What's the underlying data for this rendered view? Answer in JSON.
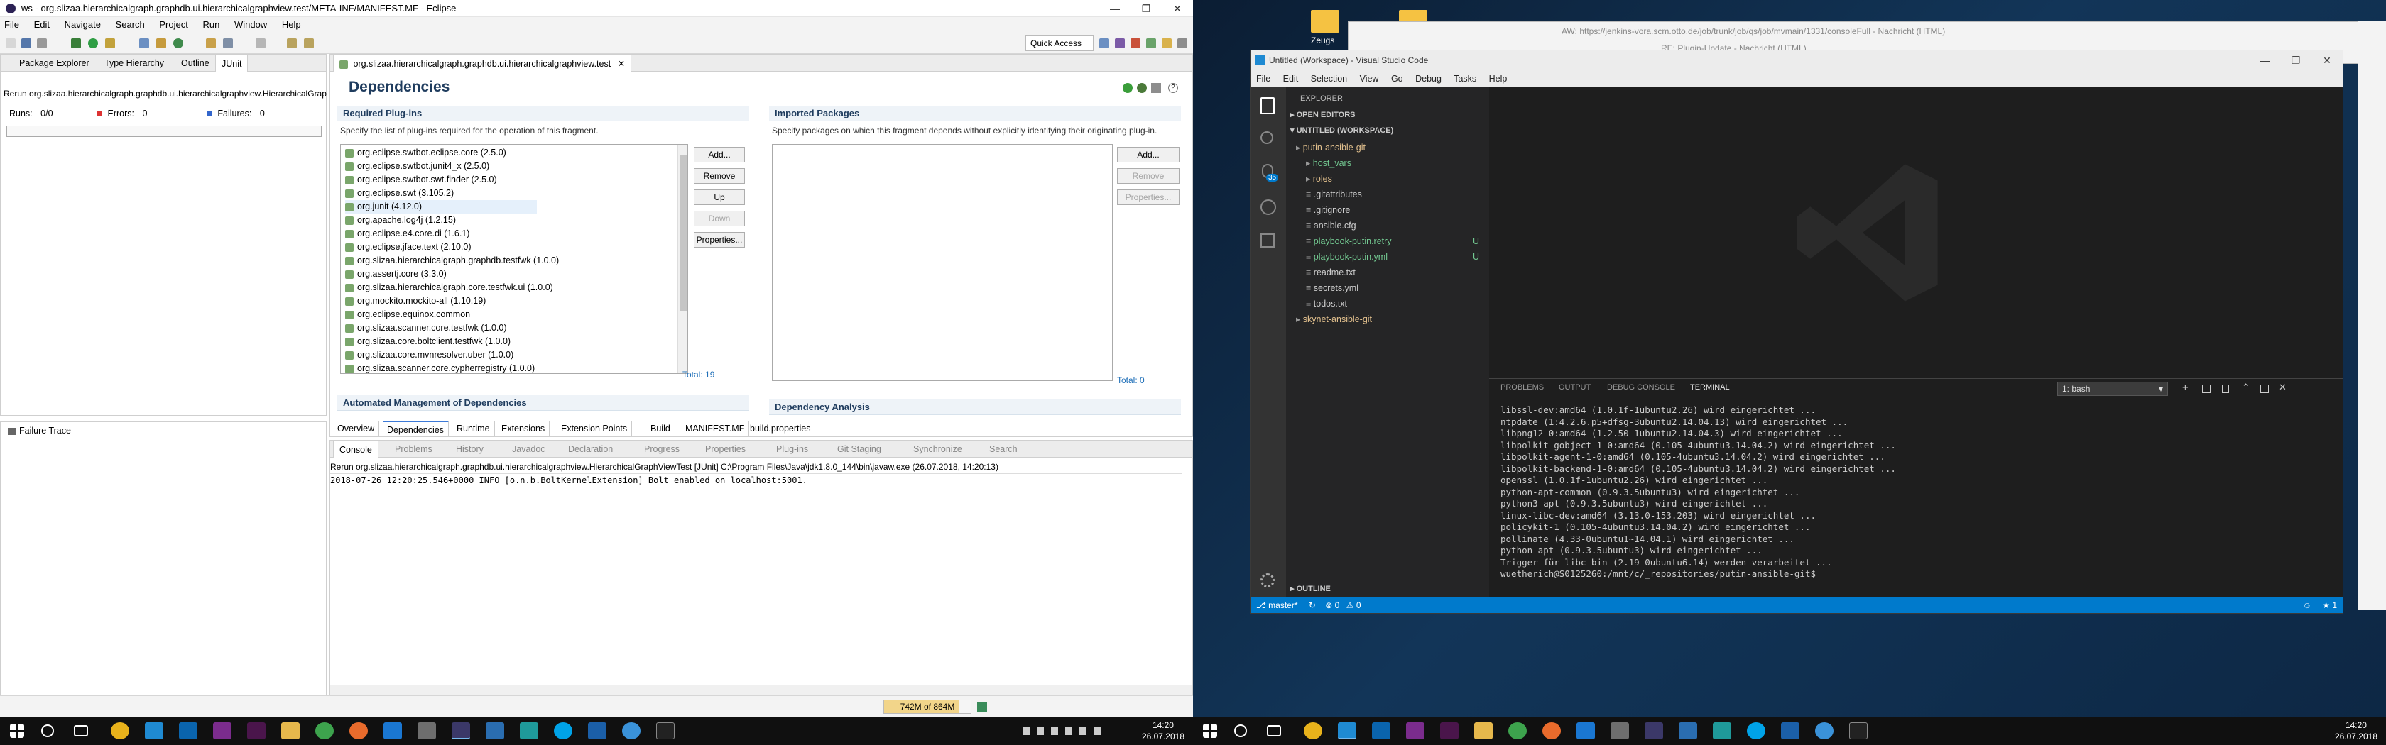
{
  "eclipse": {
    "title": "ws - org.slizaa.hierarchicalgraph.graphdb.ui.hierarchicalgraphview.test/META-INF/MANIFEST.MF - Eclipse",
    "menu": [
      "File",
      "Edit",
      "Navigate",
      "Search",
      "Project",
      "Run",
      "Window",
      "Help"
    ],
    "quick_access": "Quick Access",
    "left_tabs": [
      "Package Explorer",
      "Type Hierarchy",
      "Outline",
      "JUnit"
    ],
    "junit": {
      "rerun_text": "Rerun org.slizaa.hierarchicalgraph.graphdb.ui.hierarchicalgraphview.HierarchicalGrap",
      "runs_label": "Runs:",
      "runs_value": "0/0",
      "errors_label": "Errors:",
      "errors_value": "0",
      "failures_label": "Failures:",
      "failures_value": "0",
      "failure_trace": "Failure Trace"
    },
    "editor_tab": "org.slizaa.hierarchicalgraph.graphdb.ui.hierarchicalgraphview.test",
    "page_title": "Dependencies",
    "required": {
      "title": "Required Plug-ins",
      "desc": "Specify the list of plug-ins required for the operation of this fragment.",
      "items": [
        "org.eclipse.swtbot.eclipse.core (2.5.0)",
        "org.eclipse.swtbot.junit4_x (2.5.0)",
        "org.eclipse.swtbot.swt.finder (2.5.0)",
        "org.eclipse.swt (3.105.2)",
        "org.junit (4.12.0)",
        "org.apache.log4j (1.2.15)",
        "org.eclipse.e4.core.di (1.6.1)",
        "org.eclipse.jface.text (2.10.0)",
        "org.slizaa.hierarchicalgraph.graphdb.testfwk (1.0.0)",
        "org.assertj.core (3.3.0)",
        "org.slizaa.hierarchicalgraph.core.testfwk.ui (1.0.0)",
        "org.mockito.mockito-all (1.10.19)",
        "org.eclipse.equinox.common",
        "org.slizaa.scanner.core.testfwk (1.0.0)",
        "org.slizaa.core.boltclient.testfwk (1.0.0)",
        "org.slizaa.core.mvnresolver.uber (1.0.0)",
        "org.slizaa.scanner.core.cypherregistry (1.0.0)"
      ],
      "buttons": [
        "Add...",
        "Remove",
        "Up",
        "Down",
        "Properties..."
      ],
      "total": "Total: 19"
    },
    "imported": {
      "title": "Imported Packages",
      "desc": "Specify packages on which this fragment depends without explicitly identifying their originating plug-in.",
      "buttons": [
        "Add...",
        "Remove",
        "Properties..."
      ],
      "total": "Total: 0"
    },
    "auto_mgmt": "Automated Management of Dependencies",
    "dep_analysis": "Dependency Analysis",
    "editor_subtabs": [
      "Overview",
      "Dependencies",
      "Runtime",
      "Extensions",
      "Extension Points",
      "Build",
      "MANIFEST.MF",
      "build.properties"
    ],
    "console_tabs": [
      "Console",
      "Problems",
      "History",
      "Javadoc",
      "Declaration",
      "Progress",
      "Properties",
      "Plug-ins",
      "Git Staging",
      "Synchronize",
      "Search"
    ],
    "console_header": "Rerun org.slizaa.hierarchicalgraph.graphdb.ui.hierarchicalgraphview.HierarchicalGraphViewTest [JUnit] C:\\Program Files\\Java\\jdk1.8.0_144\\bin\\javaw.exe (26.07.2018, 14:20:13)",
    "console_line": "2018-07-26 12:20:25.546+0000 INFO [o.n.b.BoltKernelExtension] Bolt enabled on localhost:5001.",
    "heap": "742M of 864M"
  },
  "taskbar_left": {
    "time": "14:20",
    "date": "26.07.2018"
  },
  "taskbar_right": {
    "time": "14:20",
    "date": "26.07.2018"
  },
  "desktop": {
    "icon_label": "Zeugs",
    "behind_title1": "AW: https://jenkins-vora.scm.otto.de/job/trunk/job/qs/job/mvmain/1331/consoleFull - Nachricht (HTML)",
    "behind_title2": "RE: Plugin-Update - Nachricht (HTML)"
  },
  "vscode": {
    "title": "Untitled (Workspace) - Visual Studio Code",
    "menu": [
      "File",
      "Edit",
      "Selection",
      "View",
      "Go",
      "Debug",
      "Tasks",
      "Help"
    ],
    "explorer": "EXPLORER",
    "open_editors": "OPEN EDITORS",
    "workspace": "UNTITLED (WORKSPACE)",
    "tree": [
      {
        "label": "putin-ansible-git",
        "indent": 0,
        "folder": true,
        "color": "#e2c08d"
      },
      {
        "label": "host_vars",
        "indent": 1,
        "folder": true,
        "color": "#73c991"
      },
      {
        "label": "roles",
        "indent": 1,
        "folder": true,
        "color": "#e2c08d"
      },
      {
        "label": ".gitattributes",
        "indent": 1,
        "folder": false,
        "color": "#cccccc"
      },
      {
        "label": ".gitignore",
        "indent": 1,
        "folder": false,
        "color": "#cccccc"
      },
      {
        "label": "ansible.cfg",
        "indent": 1,
        "folder": false,
        "color": "#cccccc"
      },
      {
        "label": "playbook-putin.retry",
        "indent": 1,
        "folder": false,
        "color": "#73c991",
        "badge": "U"
      },
      {
        "label": "playbook-putin.yml",
        "indent": 1,
        "folder": false,
        "color": "#73c991",
        "badge": "U"
      },
      {
        "label": "readme.txt",
        "indent": 1,
        "folder": false,
        "color": "#cccccc"
      },
      {
        "label": "secrets.yml",
        "indent": 1,
        "folder": false,
        "color": "#cccccc"
      },
      {
        "label": "todos.txt",
        "indent": 1,
        "folder": false,
        "color": "#cccccc"
      },
      {
        "label": "skynet-ansible-git",
        "indent": 0,
        "folder": true,
        "color": "#e2c08d"
      }
    ],
    "outline": "OUTLINE",
    "panel_tabs": [
      "PROBLEMS",
      "OUTPUT",
      "DEBUG CONSOLE",
      "TERMINAL"
    ],
    "terminal_select": "1: bash",
    "terminal": [
      "libssl-dev:amd64 (1.0.1f-1ubuntu2.26) wird eingerichtet ...",
      "ntpdate (1:4.2.6.p5+dfsg-3ubuntu2.14.04.13) wird eingerichtet ...",
      "libpng12-0:amd64 (1.2.50-1ubuntu2.14.04.3) wird eingerichtet ...",
      "libpolkit-gobject-1-0:amd64 (0.105-4ubuntu3.14.04.2) wird eingerichtet ...",
      "libpolkit-agent-1-0:amd64 (0.105-4ubuntu3.14.04.2) wird eingerichtet ...",
      "libpolkit-backend-1-0:amd64 (0.105-4ubuntu3.14.04.2) wird eingerichtet ...",
      "openssl (1.0.1f-1ubuntu2.26) wird eingerichtet ...",
      "python-apt-common (0.9.3.5ubuntu3) wird eingerichtet ...",
      "python3-apt (0.9.3.5ubuntu3) wird eingerichtet ...",
      "linux-libc-dev:amd64 (3.13.0-153.203) wird eingerichtet ...",
      "policykit-1 (0.105-4ubuntu3.14.04.2) wird eingerichtet ...",
      "pollinate (4.33-0ubuntu1~14.04.1) wird eingerichtet ...",
      "python-apt (0.9.3.5ubuntu3) wird eingerichtet ...",
      "Trigger für libc-bin (2.19-0ubuntu6.14) werden verarbeitet ...",
      "wuetherich@S0125260:/mnt/c/_repositories/putin-ansible-git$ "
    ],
    "status_branch": "master*",
    "status_errors": "0",
    "status_warnings": "0",
    "status_bell": "1",
    "activity_badge": "35"
  }
}
